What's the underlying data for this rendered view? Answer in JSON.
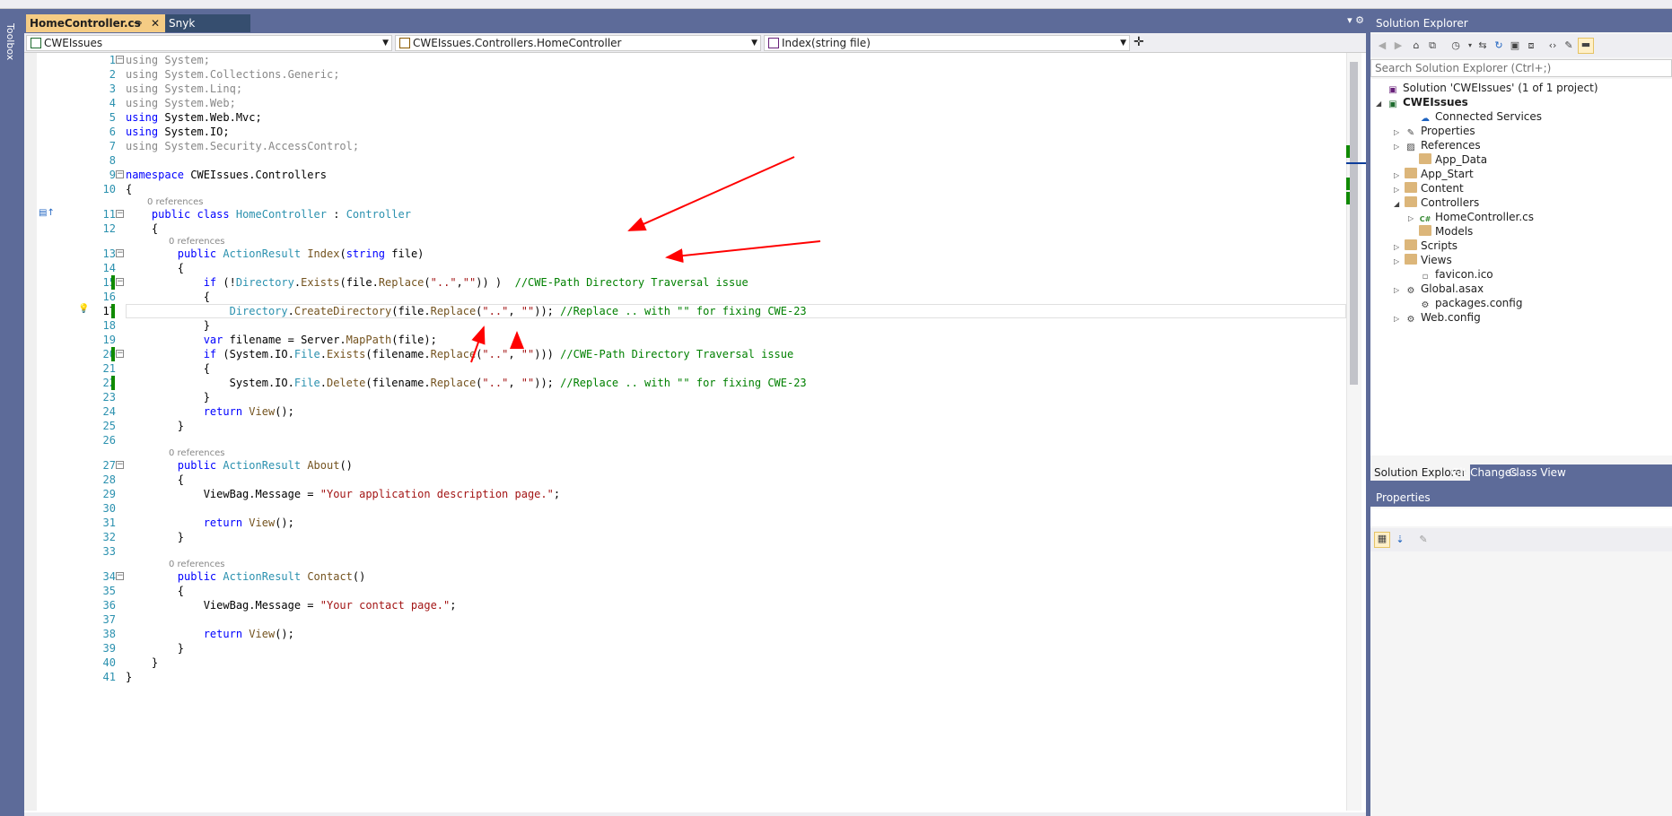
{
  "toolbox": {
    "label": "Toolbox"
  },
  "tabs": [
    {
      "label": "HomeController.cs",
      "pin": "⊸",
      "close": "✕"
    },
    {
      "label": "Snyk"
    }
  ],
  "navbar": {
    "project": "CWEIssues",
    "type": "CWEIssues.Controllers.HomeController",
    "member": "Index(string file)"
  },
  "editor": {
    "current_line": 17,
    "codelens": "0 references",
    "lines": [
      {
        "n": 1,
        "html": "<span class='dim'>using System;</span>"
      },
      {
        "n": 2,
        "html": "<span class='dim'>using System.Collections.Generic;</span>"
      },
      {
        "n": 3,
        "html": "<span class='dim'>using System.Linq;</span>"
      },
      {
        "n": 4,
        "html": "<span class='dim'>using System.Web;</span>"
      },
      {
        "n": 5,
        "html": "<span class='kw'>using</span> System.Web.Mvc;"
      },
      {
        "n": 6,
        "html": "<span class='kw'>using</span> System.IO;"
      },
      {
        "n": 7,
        "html": "<span class='dim'>using System.Security.AccessControl;</span>"
      },
      {
        "n": 8,
        "html": ""
      },
      {
        "n": 9,
        "html": "<span class='kw'>namespace</span> CWEIssues.Controllers"
      },
      {
        "n": 10,
        "html": "{"
      },
      {
        "n": 11,
        "html": "    <span class='kw'>public</span> <span class='kw'>class</span> <span class='ty'>HomeController</span> : <span class='ty'>Controller</span>"
      },
      {
        "n": 12,
        "html": "    {"
      },
      {
        "n": 13,
        "html": "        <span class='kw'>public</span> <span class='ty'>ActionResult</span> <span class='mt'>Index</span>(<span class='kw'>string</span> file)"
      },
      {
        "n": 14,
        "html": "        {"
      },
      {
        "n": 15,
        "html": "            <span class='kw'>if</span> (!<span class='ty'>Directory</span>.<span class='mt'>Exists</span>(file.<span class='mt'>Replace</span>(<span class='st'>\"..\"</span>,<span class='st'>\"\"</span>)) )  <span class='cm'>//CWE-Path Directory Traversal issue</span>"
      },
      {
        "n": 16,
        "html": "            {"
      },
      {
        "n": 17,
        "html": "                <span class='ty'>Directory</span>.<span class='mt'>CreateDirectory</span>(file.<span class='mt'>Replace</span>(<span class='st'>\"..\"</span>, <span class='st'>\"\"</span>)); <span class='cm'>//Replace .. with \"\" for fixing CWE-23</span>"
      },
      {
        "n": 18,
        "html": "            }"
      },
      {
        "n": 19,
        "html": "            <span class='kw'>var</span> filename = Server.<span class='mt'>MapPath</span>(file);"
      },
      {
        "n": 20,
        "html": "            <span class='kw'>if</span> (System.IO.<span class='ty'>File</span>.<span class='mt'>Exists</span>(filename.<span class='mt'>Replace</span>(<span class='st'>\"..\"</span>, <span class='st'>\"\"</span>))) <span class='cm'>//CWE-Path Directory Traversal issue</span>"
      },
      {
        "n": 21,
        "html": "            {"
      },
      {
        "n": 22,
        "html": "                System.IO.<span class='ty'>File</span>.<span class='mt'>Delete</span>(filename.<span class='mt'>Replace</span>(<span class='st'>\"..\"</span>, <span class='st'>\"\"</span>)); <span class='cm'>//Replace .. with \"\" for fixing CWE-23</span>"
      },
      {
        "n": 23,
        "html": "            }"
      },
      {
        "n": 24,
        "html": "            <span class='kw'>return</span> <span class='mt'>View</span>();"
      },
      {
        "n": 25,
        "html": "        }"
      },
      {
        "n": 26,
        "html": ""
      },
      {
        "n": 27,
        "html": "        <span class='kw'>public</span> <span class='ty'>ActionResult</span> <span class='mt'>About</span>()"
      },
      {
        "n": 28,
        "html": "        {"
      },
      {
        "n": 29,
        "html": "            ViewBag.Message = <span class='st'>\"Your application description page.\"</span>;"
      },
      {
        "n": 30,
        "html": ""
      },
      {
        "n": 31,
        "html": "            <span class='kw'>return</span> <span class='mt'>View</span>();"
      },
      {
        "n": 32,
        "html": "        }"
      },
      {
        "n": 33,
        "html": ""
      },
      {
        "n": 34,
        "html": "        <span class='kw'>public</span> <span class='ty'>ActionResult</span> <span class='mt'>Contact</span>()"
      },
      {
        "n": 35,
        "html": "        {"
      },
      {
        "n": 36,
        "html": "            ViewBag.Message = <span class='st'>\"Your contact page.\"</span>;"
      },
      {
        "n": 37,
        "html": ""
      },
      {
        "n": 38,
        "html": "            <span class='kw'>return</span> <span class='mt'>View</span>();"
      },
      {
        "n": 39,
        "html": "        }"
      },
      {
        "n": 40,
        "html": "    }"
      },
      {
        "n": 41,
        "html": "}"
      }
    ]
  },
  "solution_explorer": {
    "title": "Solution Explorer",
    "search_placeholder": "Search Solution Explorer (Ctrl+;)",
    "solution": "Solution 'CWEIssues' (1 of 1 project)",
    "project": "CWEIssues",
    "items": [
      {
        "label": "Connected Services",
        "icon": "connected-services-icon"
      },
      {
        "label": "Properties",
        "icon": "wrench-icon"
      },
      {
        "label": "References",
        "icon": "references-icon"
      },
      {
        "label": "App_Data",
        "icon": "folder-icon"
      },
      {
        "label": "App_Start",
        "icon": "folder-icon"
      },
      {
        "label": "Content",
        "icon": "folder-icon"
      },
      {
        "label": "Controllers",
        "icon": "folder-icon"
      },
      {
        "label": "HomeController.cs",
        "icon": "csharp-file-icon"
      },
      {
        "label": "Models",
        "icon": "folder-icon"
      },
      {
        "label": "Scripts",
        "icon": "folder-icon"
      },
      {
        "label": "Views",
        "icon": "folder-icon"
      },
      {
        "label": "favicon.ico",
        "icon": "file-icon"
      },
      {
        "label": "Global.asax",
        "icon": "config-file-icon"
      },
      {
        "label": "packages.config",
        "icon": "config-file-icon"
      },
      {
        "label": "Web.config",
        "icon": "config-file-icon"
      }
    ],
    "bottom_tabs": [
      "Solution Explorer",
      "Git Changes",
      "Class View"
    ]
  },
  "properties": {
    "title": "Properties"
  },
  "colors": {
    "accent": "#5d6b99",
    "active_tab": "#f5cc84",
    "annotation_arrow": "#ff0000"
  }
}
